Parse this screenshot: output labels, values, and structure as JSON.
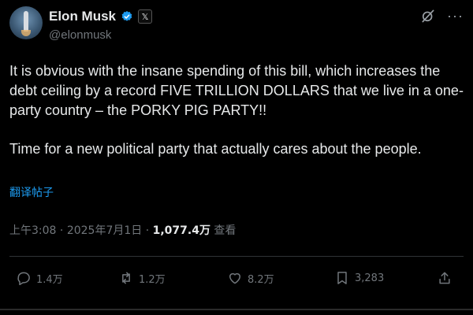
{
  "author": {
    "display_name": "Elon Musk",
    "handle": "@elonmusk",
    "badge_glyph": "𝕏"
  },
  "post": {
    "paragraph1": "It is obvious with the insane spending of this bill, which increases the debt ceiling by a record FIVE TRILLION DOLLARS that we live in a one-party country – the PORKY PIG PARTY!!",
    "paragraph2": "Time for a new political party that actually cares about the people.",
    "translate_label": "翻译帖子"
  },
  "meta": {
    "time": "上午3:08",
    "separator1": "·",
    "date": "2025年7月1日",
    "separator2": "·",
    "views": "1,077.4万",
    "views_label": "查看"
  },
  "actions": {
    "replies": "1.4万",
    "reposts": "1.2万",
    "likes": "8.2万",
    "bookmarks": "3,283"
  },
  "colors": {
    "background": "#000000",
    "text": "#e7e9ea",
    "muted": "#71767b",
    "link": "#1d9bf0",
    "verified": "#1d9bf0"
  },
  "icons": {
    "verified": "verified-badge-icon",
    "grok": "grok-icon",
    "more": "more-icon",
    "reply": "reply-icon",
    "repost": "repost-icon",
    "like": "like-icon",
    "bookmark": "bookmark-icon",
    "share": "share-icon"
  }
}
